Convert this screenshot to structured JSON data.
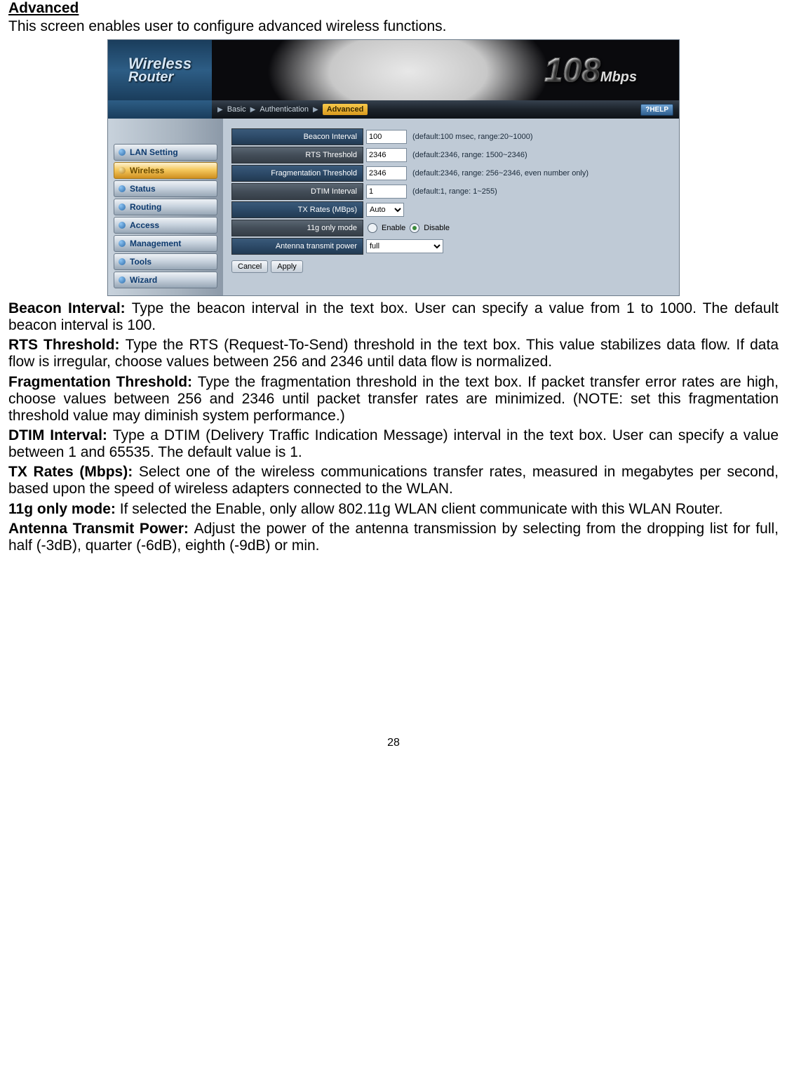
{
  "doc": {
    "section_title": "Advanced",
    "intro": "This screen enables user to configure advanced wireless functions.",
    "beacon_term": "Beacon Interval: ",
    "beacon_text": "Type the beacon interval in the text box. User can specify a value from 1 to 1000. The default beacon interval is 100.",
    "rts_term": "RTS Threshold: ",
    "rts_text": "Type the RTS (Request-To-Send) threshold in the text box. This value stabilizes data flow. If data flow is irregular, choose values between 256 and 2346 until data flow is normalized.",
    "frag_term": "Fragmentation Threshold: ",
    "frag_text": "Type the fragmentation threshold in the text box. If packet transfer error rates are high, choose values between 256 and 2346 until packet transfer rates are minimized. (NOTE: set this fragmentation threshold value may diminish system performance.)",
    "dtim_term": "DTIM Interval: ",
    "dtim_text": "Type a DTIM (Delivery Traffic Indication Message) interval in the text box. User can specify a value between 1 and 65535. The default value is 1.",
    "tx_term": "TX Rates (Mbps): ",
    "tx_text": "Select one of the wireless communications transfer rates, measured in megabytes per second, based upon the speed of wireless adapters connected to the WLAN.",
    "g11_term": "11g only mode: ",
    "g11_text": "If selected the Enable, only allow 802.11g WLAN client communicate with this WLAN Router.",
    "ant_term": "Antenna Transmit Power: ",
    "ant_text": "Adjust the power of the antenna transmission by selecting from the dropping list for full, half (-3dB), quarter (-6dB), eighth (-9dB) or min.",
    "page_number": "28"
  },
  "ui": {
    "logo_line1": "Wireless",
    "logo_line2": "Router",
    "speed_num": "108",
    "speed_unit": "Mbps",
    "breadcrumb": {
      "basic": "Basic",
      "auth": "Authentication",
      "adv": "Advanced"
    },
    "help": "HELP",
    "nav": {
      "lan": "LAN Setting",
      "wireless": "Wireless",
      "status": "Status",
      "routing": "Routing",
      "access": "Access",
      "management": "Management",
      "tools": "Tools",
      "wizard": "Wizard"
    },
    "fields": {
      "beacon": {
        "label": "Beacon Interval",
        "value": "100",
        "hint": "(default:100 msec, range:20~1000)"
      },
      "rts": {
        "label": "RTS Threshold",
        "value": "2346",
        "hint": "(default:2346, range: 1500~2346)"
      },
      "frag": {
        "label": "Fragmentation Threshold",
        "value": "2346",
        "hint": "(default:2346, range: 256~2346, even number only)"
      },
      "dtim": {
        "label": "DTIM Interval",
        "value": "1",
        "hint": "(default:1, range: 1~255)"
      },
      "tx": {
        "label": "TX Rates (MBps)",
        "value": "Auto"
      },
      "g11": {
        "label": "11g only mode",
        "enable": "Enable",
        "disable": "Disable"
      },
      "antenna": {
        "label": "Antenna transmit power",
        "value": "full"
      }
    },
    "buttons": {
      "cancel": "Cancel",
      "apply": "Apply"
    }
  }
}
